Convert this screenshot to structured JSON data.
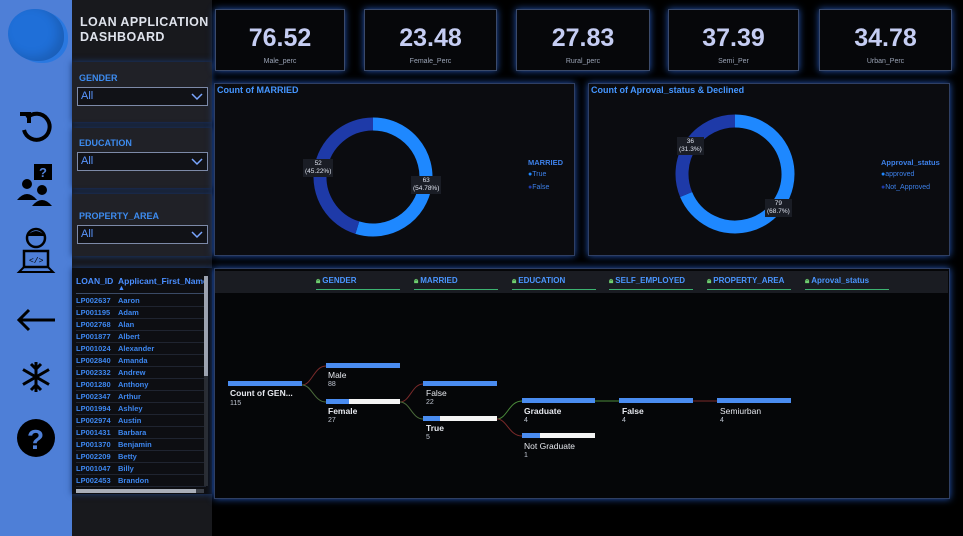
{
  "header": {
    "title_line1": "LOAN APPLICATION",
    "title_line2": "DASHBOARD"
  },
  "rail": {
    "icons": [
      "company-logo",
      "refresh-icon",
      "help-people-icon",
      "developer-icon",
      "back-arrow-icon",
      "snowflake-icon",
      "question-icon"
    ]
  },
  "filters": {
    "gender": {
      "label": "GENDER",
      "value": "All"
    },
    "education": {
      "label": "EDUCATION",
      "value": "All"
    },
    "property_area": {
      "label": "PROPERTY_AREA",
      "value": "All"
    }
  },
  "table": {
    "columns": [
      "LOAN_ID",
      "Applicant_First_Name"
    ],
    "rows": [
      [
        "LP002637",
        "Aaron"
      ],
      [
        "LP001195",
        "Adam"
      ],
      [
        "LP002768",
        "Alan"
      ],
      [
        "LP001877",
        "Albert"
      ],
      [
        "LP001024",
        "Alexander"
      ],
      [
        "LP002840",
        "Amanda"
      ],
      [
        "LP002332",
        "Andrew"
      ],
      [
        "LP001280",
        "Anthony"
      ],
      [
        "LP002347",
        "Arthur"
      ],
      [
        "LP001994",
        "Ashley"
      ],
      [
        "LP002974",
        "Austin"
      ],
      [
        "LP001431",
        "Barbara"
      ],
      [
        "LP001370",
        "Benjamin"
      ],
      [
        "LP002209",
        "Betty"
      ],
      [
        "LP001047",
        "Billy"
      ],
      [
        "LP002453",
        "Brandon"
      ]
    ]
  },
  "kpis": [
    {
      "value": "76.52",
      "label": "Male_perc"
    },
    {
      "value": "23.48",
      "label": "Female_Perc"
    },
    {
      "value": "27.83",
      "label": "Rural_perc"
    },
    {
      "value": "37.39",
      "label": "Semi_Per"
    },
    {
      "value": "34.78",
      "label": "Urban_Perc"
    }
  ],
  "married_chart": {
    "title": "Count of MARRIED",
    "legend_title": "MARRIED",
    "legend": [
      "True",
      "False"
    ],
    "label_true": "63",
    "label_true_pct": "(54.78%)",
    "label_false": "52",
    "label_false_pct": "(45.22%)"
  },
  "approval_chart": {
    "title": "Count of Aproval_status & Declined",
    "legend_title": "Approval_status",
    "legend": [
      "approved",
      "Not_Approved"
    ],
    "label_approved": "79",
    "label_approved_pct": "(68.7%)",
    "label_not": "36",
    "label_not_pct": "(31.3%)"
  },
  "colors": {
    "primary_blue": "#1e88ff",
    "dark_blue": "#1e3aa8",
    "accent": "#4596ff"
  },
  "chart_data": [
    {
      "type": "pie",
      "title": "Count of MARRIED",
      "categories": [
        "True",
        "False"
      ],
      "values": [
        63,
        52
      ],
      "percents": [
        54.78,
        45.22
      ],
      "legend_title": "MARRIED"
    },
    {
      "type": "pie",
      "title": "Count of Aproval_status & Declined",
      "categories": [
        "approved",
        "Not_Approved"
      ],
      "values": [
        79,
        36
      ],
      "percents": [
        68.7,
        31.3
      ],
      "legend_title": "Approval_status"
    }
  ],
  "tree": {
    "headers": [
      "GENDER",
      "MARRIED",
      "EDUCATION",
      "SELF_EMPLOYED",
      "PROPERTY_AREA",
      "Aproval_status"
    ],
    "root": {
      "label": "Count of GEN...",
      "value": "115"
    },
    "gender": [
      {
        "label": "Male",
        "value": "88"
      },
      {
        "label": "Female",
        "value": "27"
      }
    ],
    "married": [
      {
        "label": "False",
        "value": "22"
      },
      {
        "label": "True",
        "value": "5"
      }
    ],
    "education": [
      {
        "label": "Graduate",
        "value": "4"
      },
      {
        "label": "Not Graduate",
        "value": "1"
      }
    ],
    "self_employed": [
      {
        "label": "False",
        "value": "4"
      }
    ],
    "property_area": [
      {
        "label": "Semiurban",
        "value": "4"
      }
    ]
  }
}
